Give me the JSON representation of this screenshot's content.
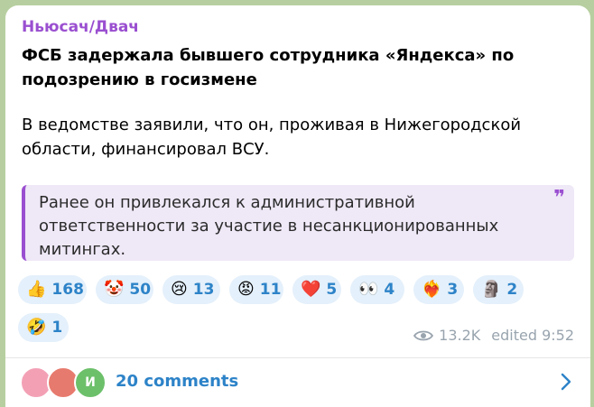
{
  "post": {
    "channel_name": "Ньюсач/Двач",
    "title": "ФСБ задержала бывшего сотрудника «Яндекса» по подозрению в госизмене",
    "body": "В ведомстве заявили, что он, проживая в Нижегородской области, финансировал ВСУ.",
    "quote": "Ранее он привлекался к административной ответственности за участие в несанкционированных митингах.",
    "quote_icon": "quote-icon"
  },
  "reactions": [
    {
      "emoji": "👍",
      "count": "168",
      "name": "thumbs-up"
    },
    {
      "emoji": "🤡",
      "count": "50",
      "name": "clown"
    },
    {
      "emoji": "😢",
      "count": "13",
      "name": "crying-face"
    },
    {
      "emoji": "😡",
      "count": "11",
      "name": "angry-face"
    },
    {
      "emoji": "❤️",
      "count": "5",
      "name": "red-heart"
    },
    {
      "emoji": "👀",
      "count": "4",
      "name": "eyes"
    },
    {
      "emoji": "❤️‍🔥",
      "count": "3",
      "name": "heart-on-fire"
    },
    {
      "emoji": "🗿",
      "count": "2",
      "name": "moai"
    },
    {
      "emoji": "🤣",
      "count": "1",
      "name": "rofl"
    }
  ],
  "meta": {
    "views": "13.2K",
    "edited": "edited 9:52"
  },
  "comments": {
    "label": "20 comments",
    "avatar_letter": "И"
  },
  "colors": {
    "accent_purple": "#9a4fd0",
    "link_blue": "#2d83c8",
    "reaction_bg": "#e4f0fb",
    "quote_bg": "#efe8f7",
    "chat_bg": "#b7cfa0"
  }
}
